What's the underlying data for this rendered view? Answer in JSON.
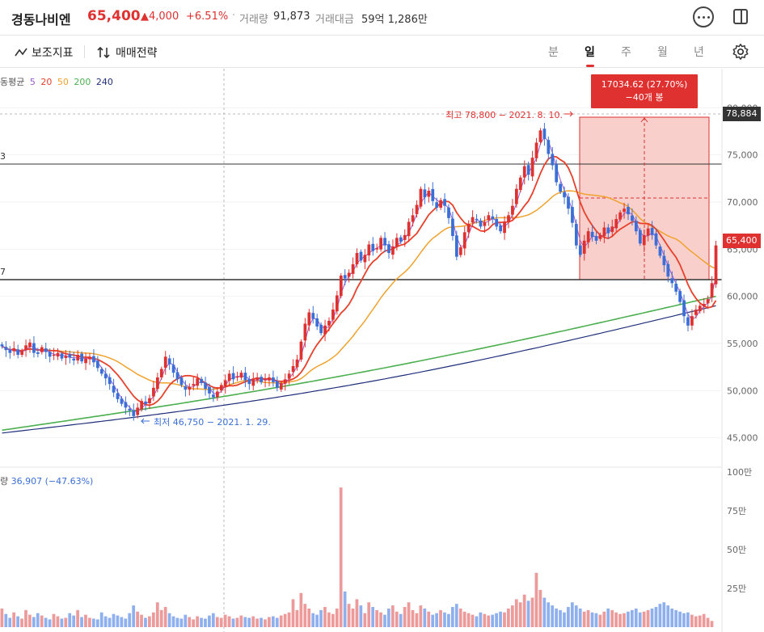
{
  "header": {
    "stock_name": "경동나비엔",
    "price": "65,400",
    "change": "▲4,000",
    "change_pct": "+6.51%",
    "separator": "·",
    "volume_label": "거래량",
    "volume_value": "91,873",
    "amount_label": "거래대금",
    "amount_value": "59억 1,286만"
  },
  "toolbar": {
    "indicator_label": "보조지표",
    "strategy_label": "매매전략",
    "periods": [
      "분",
      "일",
      "주",
      "월",
      "년"
    ],
    "active_period": "일"
  },
  "legend": {
    "ma_title": "동평균",
    "ma_periods": [
      {
        "label": "5",
        "color": "#9b59d0"
      },
      {
        "label": "20",
        "color": "#e8402a"
      },
      {
        "label": "50",
        "color": "#f0a22d"
      },
      {
        "label": "200",
        "color": "#4caf50"
      },
      {
        "label": "240",
        "color": "#1f2f7a"
      }
    ],
    "volume_prefix": "량",
    "volume_value": "36,907 (−47.63%)"
  },
  "annotations": {
    "high": "최고 78,800 − 2021. 8. 10.",
    "low": "최저 46,750 − 2021. 1. 29.",
    "measure_value": "17034.62 (27.70%)",
    "measure_bars": "−40개 봉",
    "hline_1_label": "3",
    "hline_2_label": "7",
    "high_tag": "78,884",
    "current_tag": "65,400"
  },
  "colors": {
    "up": "#e03131",
    "down": "#3b6fd8",
    "ma5": "#9b59d0",
    "ma20": "#e8402a",
    "ma50": "#f0a22d",
    "ma200": "#4caf50",
    "ma240": "#1f2f7a"
  },
  "chart_data": {
    "type": "candlestick",
    "price_axis": {
      "ticks": [
        45000,
        50000,
        55000,
        60000,
        65000,
        70000,
        75000,
        80000
      ],
      "tick_labels": [
        "45,000",
        "50,000",
        "55,000",
        "60,000",
        "65,000",
        "70,000",
        "75,000",
        "80,000"
      ],
      "range": [
        43000,
        82000
      ]
    },
    "volume_axis": {
      "tick_labels": [
        "100만",
        "75만",
        "50만",
        "25만"
      ],
      "ticks": [
        1000000,
        750000,
        500000,
        250000
      ],
      "range": [
        0,
        1000000
      ]
    },
    "horizontal_lines": [
      73600,
      61300
    ],
    "close": [
      54700,
      54300,
      54000,
      54500,
      53800,
      54200,
      54800,
      55100,
      54000,
      53900,
      54600,
      54100,
      53600,
      53800,
      54000,
      53400,
      53700,
      53500,
      53200,
      53800,
      53100,
      53400,
      53600,
      53000,
      52400,
      51800,
      51300,
      50700,
      49800,
      49100,
      48600,
      48200,
      47900,
      47300,
      48200,
      48900,
      48600,
      49200,
      50300,
      51400,
      52300,
      53600,
      52800,
      51900,
      51200,
      50600,
      50100,
      50400,
      50700,
      51300,
      50800,
      50200,
      49700,
      49300,
      49900,
      50600,
      51100,
      51800,
      51200,
      51500,
      51900,
      51100,
      50700,
      51200,
      51400,
      50900,
      51200,
      51400,
      50900,
      50300,
      50800,
      51200,
      51800,
      52600,
      53300,
      55200,
      57100,
      58300,
      57600,
      56800,
      56100,
      56900,
      57400,
      58600,
      60100,
      62200,
      61900,
      62500,
      63400,
      64600,
      63800,
      64400,
      65500,
      64800,
      65100,
      66200,
      65400,
      64600,
      65300,
      66200,
      65800,
      66500,
      67900,
      68600,
      69700,
      71400,
      70500,
      71200,
      70100,
      69400,
      70200,
      69600,
      68300,
      66400,
      64200,
      65200,
      66800,
      67700,
      68400,
      68100,
      67400,
      67900,
      68600,
      68200,
      67400,
      66900,
      67900,
      68600,
      69600,
      71400,
      72600,
      73800,
      72900,
      74700,
      76300,
      77600,
      76700,
      75100,
      73900,
      72100,
      71100,
      70500,
      69300,
      67800,
      65400,
      64400,
      65900,
      66900,
      66300,
      65900,
      66500,
      67300,
      66700,
      67400,
      68200,
      68900,
      69300,
      68700,
      68000,
      66900,
      65600,
      66500,
      67200,
      66500,
      65400,
      64300,
      63300,
      62100,
      61400,
      60500,
      59400,
      57900,
      56900,
      57900,
      58600,
      59000,
      59200,
      59700,
      61400,
      65400
    ],
    "volume": [
      120000,
      85000,
      60000,
      95000,
      70000,
      55000,
      110000,
      80000,
      65000,
      90000,
      75000,
      60000,
      50000,
      85000,
      70000,
      55000,
      60000,
      90000,
      75000,
      110000,
      65000,
      80000,
      60000,
      55000,
      50000,
      95000,
      70000,
      60000,
      85000,
      75000,
      65000,
      55000,
      90000,
      140000,
      100000,
      80000,
      60000,
      70000,
      95000,
      160000,
      110000,
      130000,
      90000,
      70000,
      60000,
      55000,
      80000,
      65000,
      50000,
      70000,
      60000,
      55000,
      75000,
      90000,
      65000,
      60000,
      80000,
      70000,
      55000,
      60000,
      75000,
      65000,
      60000,
      70000,
      55000,
      60000,
      50000,
      65000,
      70000,
      60000,
      75000,
      85000,
      95000,
      180000,
      110000,
      220000,
      150000,
      120000,
      90000,
      80000,
      110000,
      130000,
      95000,
      85000,
      120000,
      900000,
      230000,
      150000,
      120000,
      180000,
      140000,
      90000,
      160000,
      130000,
      110000,
      95000,
      80000,
      120000,
      140000,
      100000,
      85000,
      130000,
      160000,
      110000,
      90000,
      140000,
      120000,
      100000,
      80000,
      90000,
      110000,
      95000,
      85000,
      130000,
      150000,
      120000,
      100000,
      90000,
      80000,
      70000,
      95000,
      85000,
      75000,
      80000,
      90000,
      100000,
      95000,
      120000,
      140000,
      180000,
      160000,
      210000,
      170000,
      190000,
      350000,
      240000,
      190000,
      160000,
      140000,
      120000,
      110000,
      95000,
      130000,
      160000,
      140000,
      120000,
      100000,
      110000,
      95000,
      90000,
      80000,
      100000,
      120000,
      110000,
      95000,
      85000,
      90000,
      100000,
      110000,
      120000,
      95000,
      100000,
      110000,
      120000,
      130000,
      150000,
      160000,
      140000,
      120000,
      110000,
      100000,
      90000,
      95000,
      80000,
      70000,
      75000,
      85000,
      60000,
      40000
    ]
  }
}
